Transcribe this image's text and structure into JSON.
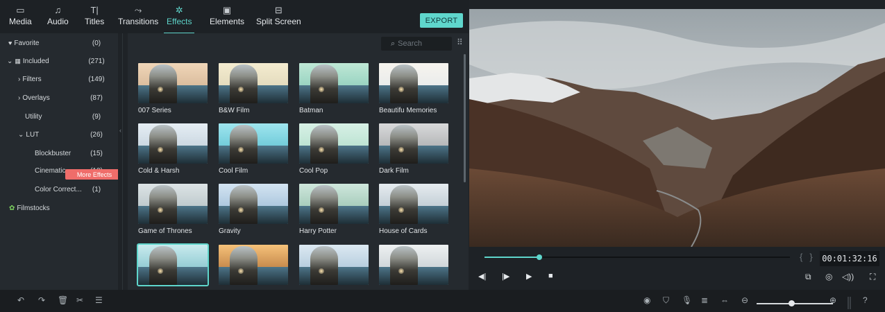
{
  "tabs": [
    {
      "label": "Media",
      "icon": "folder-icon",
      "glyph": "▭"
    },
    {
      "label": "Audio",
      "icon": "music-note-icon",
      "glyph": "♫"
    },
    {
      "label": "Titles",
      "icon": "title-text-icon",
      "glyph": "T|"
    },
    {
      "label": "Transitions",
      "icon": "transition-icon",
      "glyph": "⤳"
    },
    {
      "label": "Effects",
      "icon": "effects-icon",
      "glyph": "✲"
    },
    {
      "label": "Elements",
      "icon": "image-icon",
      "glyph": "▣"
    },
    {
      "label": "Split Screen",
      "icon": "split-screen-icon",
      "glyph": "⊟"
    }
  ],
  "active_tab": "Effects",
  "export_label": "EXPORT",
  "sidebar": {
    "items": [
      {
        "label": "Favorite",
        "count": "(0)"
      },
      {
        "label": "Included",
        "count": "(271)"
      },
      {
        "label": "Filters",
        "count": "(149)"
      },
      {
        "label": "Overlays",
        "count": "(87)"
      },
      {
        "label": "Utility",
        "count": "(9)"
      },
      {
        "label": "LUT",
        "count": "(26)"
      },
      {
        "label": "Blockbuster",
        "count": "(15)"
      },
      {
        "label": "Cinematic",
        "count": "(10)"
      },
      {
        "label": "Color Correct...",
        "count": "(1)"
      },
      {
        "label": "Filmstocks",
        "count": ""
      }
    ],
    "more_effects": "More Effects"
  },
  "search": {
    "placeholder": "Search"
  },
  "effects": [
    {
      "name": "007 Series",
      "tone": "warm"
    },
    {
      "name": "B&W Film",
      "tone": "cream"
    },
    {
      "name": "Batman",
      "tone": "teal"
    },
    {
      "name": "Beautifu Memories",
      "tone": "bright"
    },
    {
      "name": "Cold & Harsh",
      "tone": "cold"
    },
    {
      "name": "Cool Film",
      "tone": "cyan"
    },
    {
      "name": "Cool Pop",
      "tone": "mint"
    },
    {
      "name": "Dark Film",
      "tone": "dark"
    },
    {
      "name": "Game of Thrones",
      "tone": "muted"
    },
    {
      "name": "Gravity",
      "tone": "blue"
    },
    {
      "name": "Harry Potter",
      "tone": "green"
    },
    {
      "name": "House of Cards",
      "tone": "steel"
    },
    {
      "name": "",
      "tone": "teal2"
    },
    {
      "name": "",
      "tone": "golden"
    },
    {
      "name": "",
      "tone": "cool2"
    },
    {
      "name": "",
      "tone": "neutral"
    }
  ],
  "selected_effect_index": 12,
  "player": {
    "timecode": "00:01:32:16",
    "progress": 0.18
  },
  "zoom_level": 0.45,
  "colors": {
    "accent": "#5fd6cc",
    "more_effects_badge": "#ef6d6a"
  }
}
